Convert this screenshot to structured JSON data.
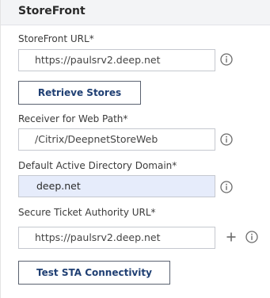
{
  "section": {
    "title": "StoreFront"
  },
  "fields": {
    "storefront_url": {
      "label": "StoreFront URL*",
      "value": "https://paulsrv2.deep.net"
    },
    "receiver_web_path": {
      "label": "Receiver for Web Path*",
      "value": "/Citrix/DeepnetStoreWeb"
    },
    "ad_domain": {
      "label": "Default Active Directory Domain*",
      "value": "deep.net"
    },
    "sta_url": {
      "label": "Secure Ticket Authority URL*",
      "value": "https://paulsrv2.deep.net"
    }
  },
  "buttons": {
    "retrieve_stores": "Retrieve Stores",
    "test_sta": "Test STA Connectivity"
  },
  "icons": {
    "info": "info-icon",
    "add": "plus-icon"
  },
  "colors": {
    "header_bg": "#f3f4f6",
    "autofill_bg": "#e6ecfb",
    "button_text": "#1f3f73",
    "icon_gray": "#6b6b6b"
  }
}
